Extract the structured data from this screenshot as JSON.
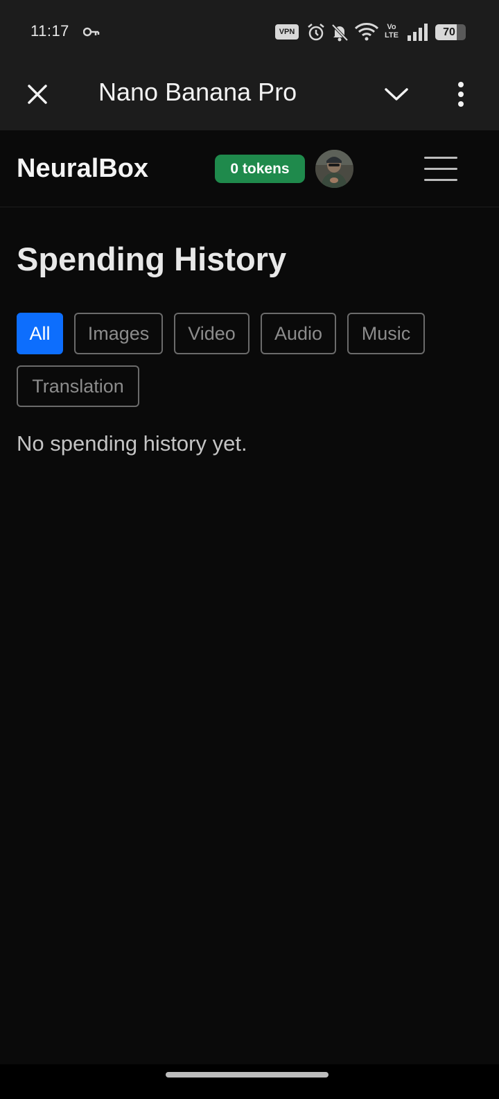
{
  "status_bar": {
    "time": "11:17",
    "vpn_label": "VPN",
    "volte_label": "Vo\nLTE",
    "battery_percent": 70,
    "battery_label": "70",
    "icons": [
      "key-icon",
      "vpn-icon",
      "alarm-icon",
      "bell-off-icon",
      "wifi-icon",
      "volte-icon",
      "signal-icon",
      "battery-icon"
    ]
  },
  "app_bar": {
    "title": "Nano Banana Pro",
    "icons": [
      "close-icon",
      "chevron-down-icon",
      "more-vertical-icon"
    ]
  },
  "header": {
    "brand": "NeuralBox",
    "tokens": "0 tokens",
    "tokens_color": "#1f8a4c",
    "icons": [
      "avatar",
      "hamburger-menu-icon"
    ]
  },
  "page": {
    "title": "Spending History",
    "filters": [
      {
        "label": "All",
        "active": true
      },
      {
        "label": "Images",
        "active": false
      },
      {
        "label": "Video",
        "active": false
      },
      {
        "label": "Audio",
        "active": false
      },
      {
        "label": "Music",
        "active": false
      },
      {
        "label": "Translation",
        "active": false
      }
    ],
    "empty_message": "No spending history yet.",
    "accent_color": "#0d6efd"
  }
}
